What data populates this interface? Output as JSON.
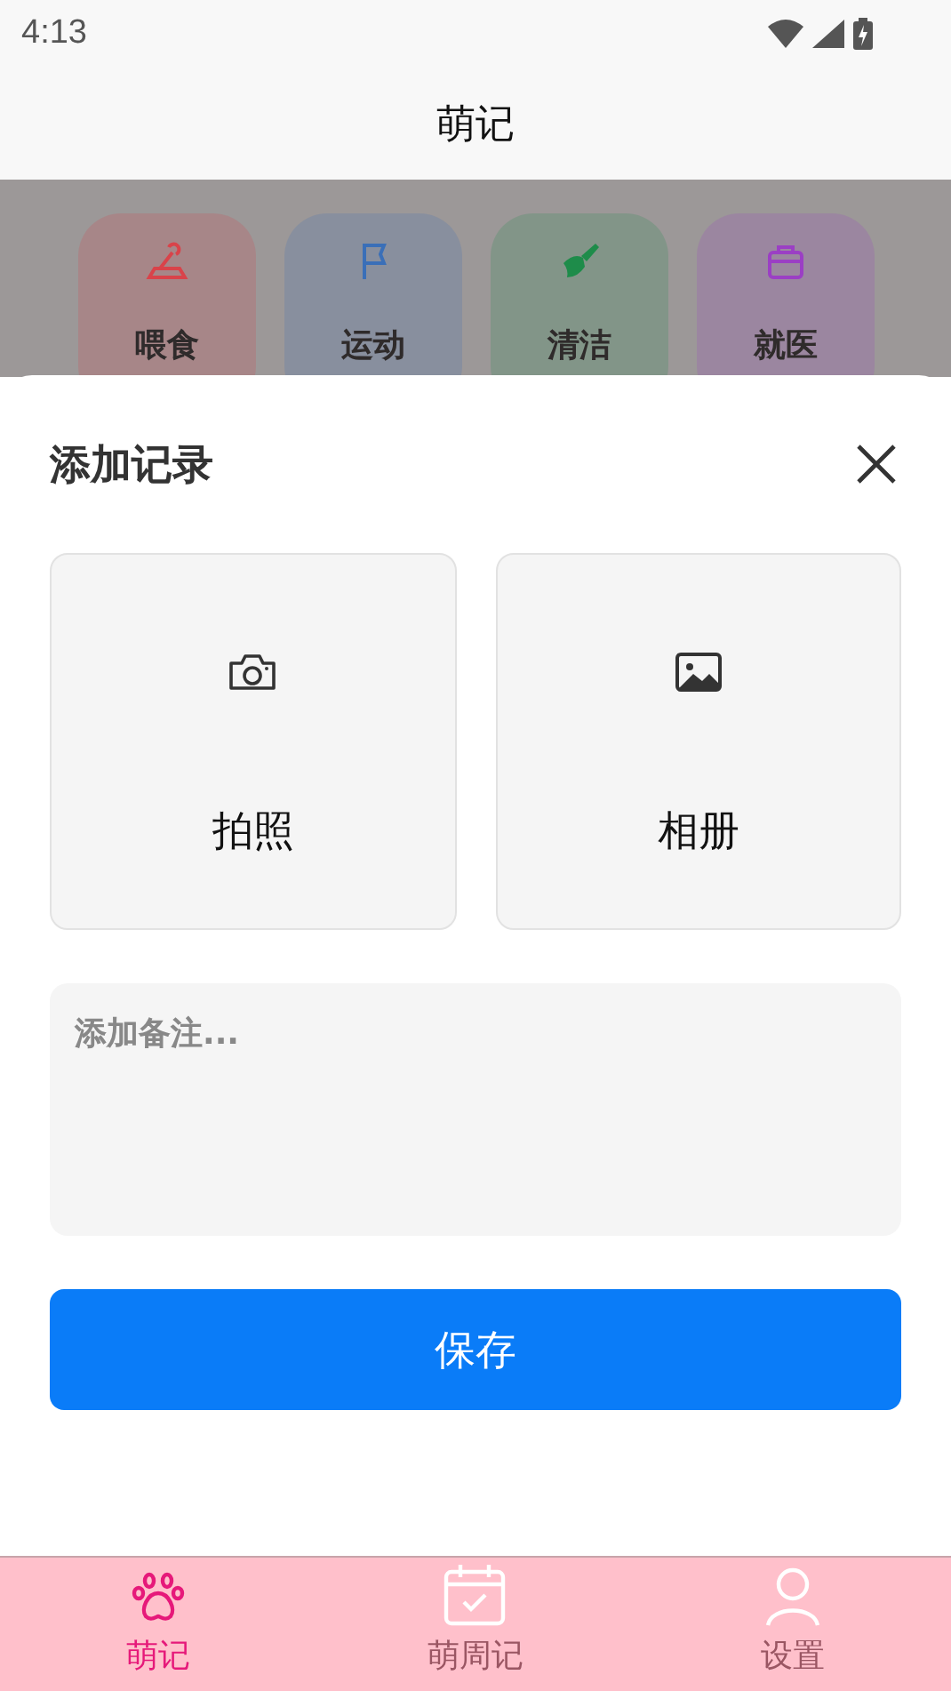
{
  "status_bar": {
    "time": "4:13"
  },
  "header": {
    "title": "萌记"
  },
  "categories": [
    {
      "label": "喂食",
      "kind": "feed",
      "color": "#d9434a"
    },
    {
      "label": "运动",
      "kind": "flag",
      "color": "#3a6fb8"
    },
    {
      "label": "清洁",
      "kind": "broom",
      "color": "#1e8c4a"
    },
    {
      "label": "就医",
      "kind": "kit",
      "color": "#9b3fc4"
    }
  ],
  "sheet": {
    "title": "添加记录",
    "options": [
      {
        "label": "拍照",
        "kind": "camera"
      },
      {
        "label": "相册",
        "kind": "gallery"
      }
    ],
    "note": {
      "placeholder": "添加备注..."
    },
    "save": "保存"
  },
  "tab_bar": [
    {
      "label": "萌记",
      "kind": "paw",
      "selected": true
    },
    {
      "label": "萌周记",
      "kind": "calendar",
      "selected": false
    },
    {
      "label": "设置",
      "kind": "person",
      "selected": false
    }
  ]
}
